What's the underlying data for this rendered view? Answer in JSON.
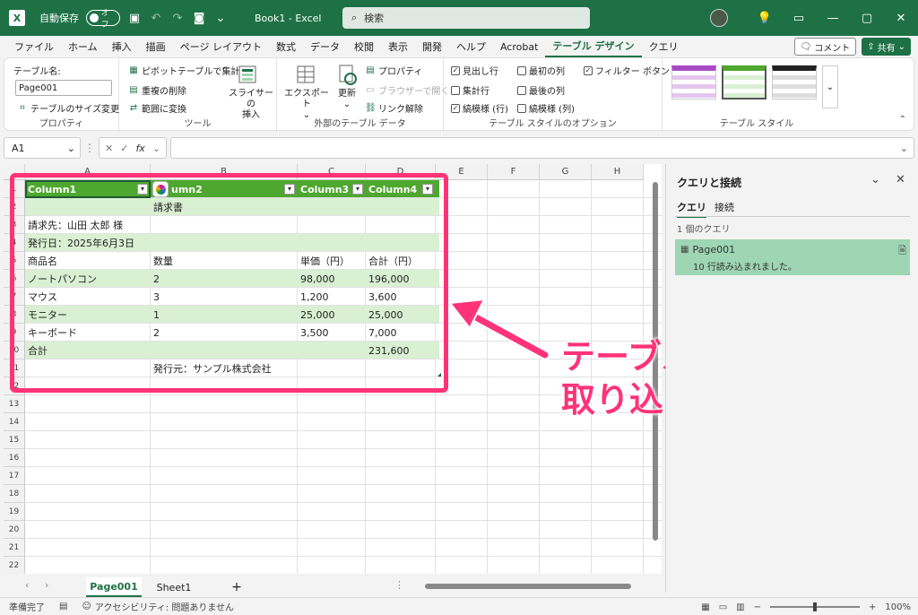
{
  "titlebar": {
    "autosave_label": "自動保存",
    "autosave_state": "オフ",
    "document": "Book1 - Excel",
    "search_placeholder": "検索"
  },
  "menu": {
    "tabs": [
      "ファイル",
      "ホーム",
      "挿入",
      "描画",
      "ページ レイアウト",
      "数式",
      "データ",
      "校閲",
      "表示",
      "開発",
      "ヘルプ",
      "Acrobat",
      "テーブル デザイン",
      "クエリ"
    ],
    "active_tab": "テーブル デザイン",
    "comment_label": "コメント",
    "share_label": "共有"
  },
  "ribbon": {
    "properties": {
      "table_name_label": "テーブル名:",
      "table_name_value": "Page001",
      "resize_label": "テーブルのサイズ変更",
      "group_label": "プロパティ"
    },
    "tools": {
      "pivot_label": "ピボットテーブルで集計",
      "remove_dup_label": "重複の削除",
      "convert_label": "範囲に変換",
      "slicer_label_1": "スライサーの",
      "slicer_label_2": "挿入",
      "group_label": "ツール"
    },
    "external": {
      "export_label": "エクスポート",
      "refresh_label": "更新",
      "properties_label": "プロパティ",
      "browser_label": "ブラウザーで開く",
      "unlink_label": "リンク解除",
      "group_label": "外部のテーブル データ"
    },
    "style_options": {
      "header_row": "見出し行",
      "total_row": "集計行",
      "banded_rows": "縞模様 (行)",
      "first_column": "最初の列",
      "last_column": "最後の列",
      "banded_columns": "縞模様 (列)",
      "filter_button": "フィルター ボタン",
      "group_label": "テーブル スタイルのオプション"
    },
    "styles": {
      "group_label": "テーブル スタイル"
    }
  },
  "formula_bar": {
    "name_box": "A1",
    "fx": "fx",
    "value": ""
  },
  "grid": {
    "columns": [
      "A",
      "B",
      "C",
      "D",
      "E",
      "F",
      "G",
      "H"
    ],
    "rows": [
      "1",
      "2",
      "3",
      "4",
      "5",
      "6",
      "7",
      "8",
      "9",
      "10",
      "11",
      "12",
      "13",
      "14",
      "15",
      "16",
      "17",
      "18",
      "19",
      "20",
      "21",
      "22"
    ],
    "table_headers": [
      "Column1",
      "umn2",
      "Column3",
      "Column4"
    ],
    "table_rows": [
      [
        "",
        "請求書",
        "",
        ""
      ],
      [
        "請求先：山田 太郎 様",
        "",
        "",
        ""
      ],
      [
        "発行日：2025年6月3日",
        "",
        "",
        ""
      ],
      [
        "商品名",
        "数量",
        "単価（円）",
        "合計（円）"
      ],
      [
        "ノートパソコン",
        "2",
        "98,000",
        "196,000"
      ],
      [
        "マウス",
        "3",
        "1,200",
        "3,600"
      ],
      [
        "モニター",
        "1",
        "25,000",
        "25,000"
      ],
      [
        "キーボード",
        "2",
        "3,500",
        "7,000"
      ],
      [
        "合計",
        "",
        "",
        "231,600"
      ],
      [
        "",
        "発行元：サンプル株式会社",
        "",
        ""
      ]
    ]
  },
  "annotation": {
    "line1": "テーブルとして",
    "line2": "取り込まれる",
    "color": "#ff3377"
  },
  "pane": {
    "title": "クエリと接続",
    "tab_queries": "クエリ",
    "tab_connections": "接続",
    "count": "1 個のクエリ",
    "query_name": "Page001",
    "query_status": "10 行読み込まれました。"
  },
  "sheets": {
    "tabs": [
      "Page001",
      "Sheet1"
    ],
    "active": "Page001"
  },
  "status": {
    "ready": "準備完了",
    "accessibility": "アクセシビリティ: 問題ありません",
    "zoom": "100%"
  },
  "colors": {
    "brand": "#1e7145",
    "table_header": "#4ea72e",
    "band": "#d9f0d3",
    "query_card": "#9ed6b4"
  }
}
